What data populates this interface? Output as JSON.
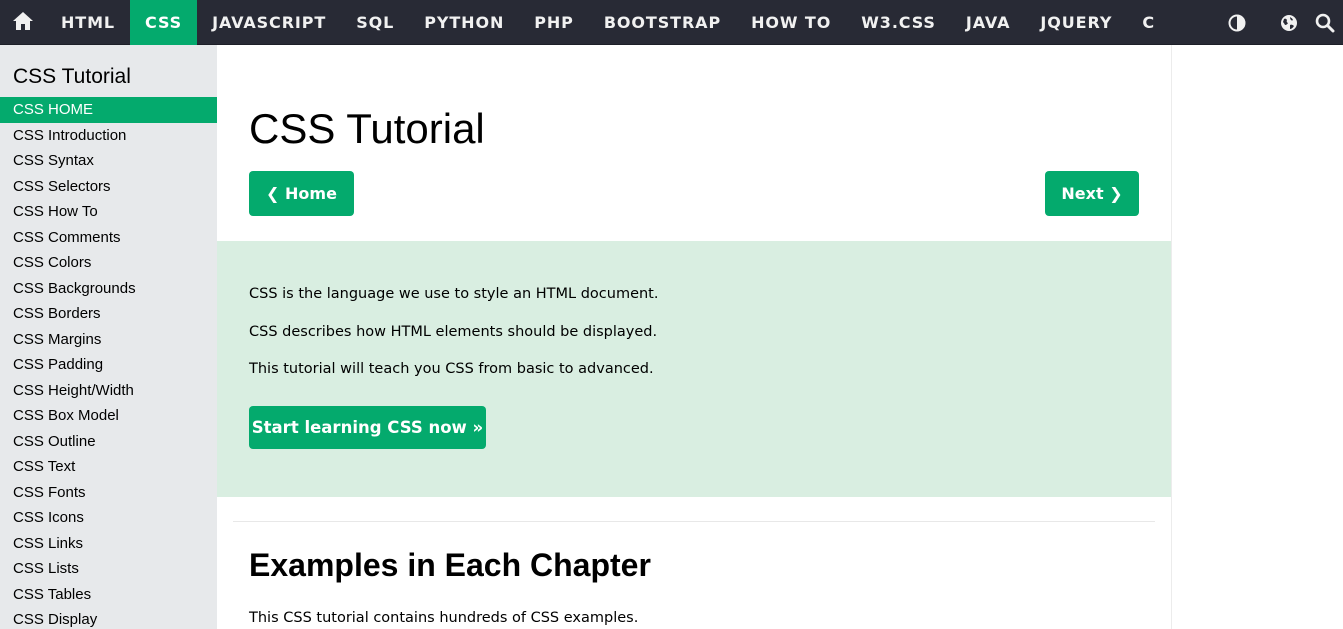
{
  "topnav": {
    "home_icon": "home-icon",
    "items": [
      {
        "label": "HTML",
        "active": false
      },
      {
        "label": "CSS",
        "active": true
      },
      {
        "label": "JAVASCRIPT",
        "active": false
      },
      {
        "label": "SQL",
        "active": false
      },
      {
        "label": "PYTHON",
        "active": false
      },
      {
        "label": "PHP",
        "active": false
      },
      {
        "label": "BOOTSTRAP",
        "active": false
      },
      {
        "label": "HOW TO",
        "active": false
      },
      {
        "label": "W3.CSS",
        "active": false
      },
      {
        "label": "JAVA",
        "active": false
      },
      {
        "label": "JQUERY",
        "active": false
      },
      {
        "label": "C",
        "active": false
      }
    ],
    "right_icons": [
      "contrast-icon",
      "globe-icon",
      "search-icon"
    ],
    "bg_color": "#282a35",
    "active_color": "#04aa6d"
  },
  "sidebar": {
    "title": "CSS Tutorial",
    "items": [
      {
        "label": "CSS HOME",
        "active": true
      },
      {
        "label": "CSS Introduction",
        "active": false
      },
      {
        "label": "CSS Syntax",
        "active": false
      },
      {
        "label": "CSS Selectors",
        "active": false
      },
      {
        "label": "CSS How To",
        "active": false
      },
      {
        "label": "CSS Comments",
        "active": false
      },
      {
        "label": "CSS Colors",
        "active": false
      },
      {
        "label": "CSS Backgrounds",
        "active": false
      },
      {
        "label": "CSS Borders",
        "active": false
      },
      {
        "label": "CSS Margins",
        "active": false
      },
      {
        "label": "CSS Padding",
        "active": false
      },
      {
        "label": "CSS Height/Width",
        "active": false
      },
      {
        "label": "CSS Box Model",
        "active": false
      },
      {
        "label": "CSS Outline",
        "active": false
      },
      {
        "label": "CSS Text",
        "active": false
      },
      {
        "label": "CSS Fonts",
        "active": false
      },
      {
        "label": "CSS Icons",
        "active": false
      },
      {
        "label": "CSS Links",
        "active": false
      },
      {
        "label": "CSS Lists",
        "active": false
      },
      {
        "label": "CSS Tables",
        "active": false
      },
      {
        "label": "CSS Display",
        "active": false
      }
    ],
    "bg_color": "#e7e9eb"
  },
  "main": {
    "title": "CSS Tutorial",
    "prev_button": "❮ Home",
    "next_button": "Next ❯",
    "intro": {
      "lines": [
        "CSS is the language we use to style an HTML document.",
        "CSS describes how HTML elements should be displayed.",
        "This tutorial will teach you CSS from basic to advanced."
      ],
      "cta_button": "Start learning CSS now »",
      "bg_color": "#d9eee1"
    },
    "section": {
      "title": "Examples in Each Chapter",
      "text": "This CSS tutorial contains hundreds of CSS examples."
    },
    "accent_color": "#04aa6d"
  }
}
